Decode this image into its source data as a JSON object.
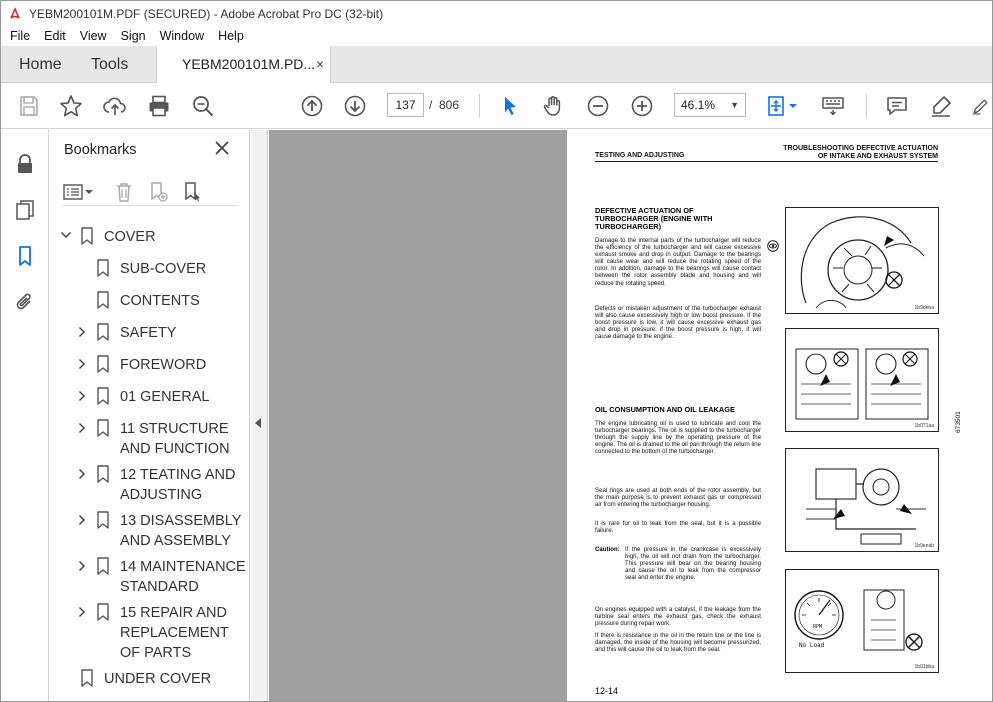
{
  "window": {
    "title": "YEBM200101M.PDF (SECURED) - Adobe Acrobat Pro DC (32-bit)"
  },
  "menu": {
    "items": [
      "File",
      "Edit",
      "View",
      "Sign",
      "Window",
      "Help"
    ]
  },
  "tabs": {
    "home": "Home",
    "tools": "Tools",
    "document": "YEBM200101M.PD...",
    "close_glyph": "×"
  },
  "toolbar": {
    "icons": [
      "save-icon",
      "bookmark-star-icon",
      "upload-icon",
      "print-icon",
      "zoom-search-icon",
      "page-up-icon",
      "page-down-icon",
      "select-cursor-icon",
      "hand-icon",
      "zoom-out-icon",
      "zoom-in-icon",
      "page-layout-icon",
      "keyboard-icon",
      "comment-icon",
      "highlight-pen-icon",
      "sign-icon"
    ],
    "current_page": "137",
    "page_separator": "/",
    "total_pages": "806",
    "zoom": "46.1%",
    "accent_color": "#1473e6"
  },
  "bookmarks": {
    "header": "Bookmarks",
    "items": [
      {
        "label": "COVER",
        "expanded": true,
        "level": 0
      },
      {
        "label": "SUB-COVER",
        "level": 1
      },
      {
        "label": "CONTENTS",
        "level": 1
      },
      {
        "label": "SAFETY",
        "level": 1,
        "has_children": true
      },
      {
        "label": "FOREWORD",
        "level": 1,
        "has_children": true
      },
      {
        "label": "01 GENERAL",
        "level": 1,
        "has_children": true
      },
      {
        "label": "11 STRUCTURE AND FUNCTION",
        "level": 1,
        "has_children": true
      },
      {
        "label": "12 TEATING AND ADJUSTING",
        "level": 1,
        "has_children": true
      },
      {
        "label": "13 DISASSEMBLY AND ASSEMBLY",
        "level": 1,
        "has_children": true
      },
      {
        "label": "14 MAINTENANCE STANDARD",
        "level": 1,
        "has_children": true
      },
      {
        "label": "15 REPAIR AND REPLACEMENT OF PARTS",
        "level": 1,
        "has_children": true
      },
      {
        "label": "UNDER COVER",
        "level": 0
      }
    ]
  },
  "pdf_page": {
    "header_left": "TESTING AND ADJUSTING",
    "header_right_1": "TROUBLESHOOTING DEFECTIVE ACTUATION",
    "header_right_2": "OF INTAKE AND EXHAUST SYSTEM",
    "section1_title_1": "DEFECTIVE ACTUATION OF",
    "section1_title_2": "TURBOCHARGER (ENGINE WITH",
    "section1_title_3": "TURBOCHARGER)",
    "section1_p1": "Damage to the internal parts of the turbocharger will reduce the efficiency of the turbocharger and will cause excessive exhaust smoke and drop in output. Damage to the bearings will cause wear and will reduce the rotating speed of the rotor. In addition, damage to the bearings will cause contact between the rotor assembly blade and housing and will reduce the rotating speed.",
    "section1_p2": "Defects or mistaken adjustment of the turbocharger exhaust will also cause excessively high or low boost pressure. If the boost pressure is low, it will cause excessive exhaust gas and drop in pressure; if the boost pressure is high, it will cause damage to the engine.",
    "section2_title": "OIL CONSUMPTION AND OIL LEAKAGE",
    "section2_p1": "The engine lubricating oil is used to lubricate and cool the turbocharger bearings. The oil is supplied to the turbocharger through the supply line by the operating pressure of the engine. The oil is drained to the oil pan through the return line connected to the bottom of the turbocharger.",
    "section2_p2": "Seal rings are used at both ends of the rotor assembly, but the main purpose is to prevent exhaust gas or compressed air from entering the turbocharger housing.",
    "section2_p3": "It is rare for oil to leak from the seal, but it is a possible failure.",
    "caution_label": "Caution:",
    "caution_text": "If the pressure in the crankcase is excessively high, the oil will not drain from the turbocharger. This pressure will bear on the bearing housing and cause the oil to leak from the compressor seal and enter the engine.",
    "section2_p4": "On engines equipped with a catalyst, if the leakage from the turbine seal enters the exhaust gas, check the exhaust pressure during repair work.",
    "section2_p5": "If there is resistance in the oil in the return line or the line is damaged, the inside of the housing will become pressurized, and this will cause the oil to leak from the seal.",
    "fig1_caption": "1b9deba",
    "fig2_caption": "1b071aa",
    "fig3_caption": "1b9eeab",
    "fig4_caption": "1b01bba",
    "fig4_gauge_label": "RPM",
    "fig4_noload": "No Load",
    "side_code": "673501",
    "page_number": "12-14"
  }
}
